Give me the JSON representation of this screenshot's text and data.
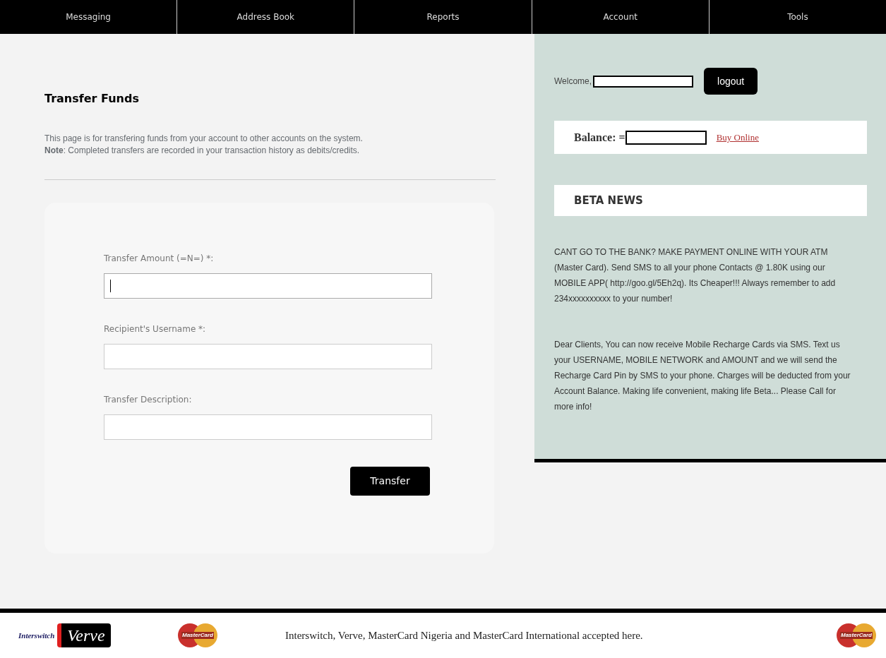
{
  "nav": [
    {
      "label": "Messaging"
    },
    {
      "label": "Address Book"
    },
    {
      "label": "Reports"
    },
    {
      "label": "Account"
    },
    {
      "label": "Tools"
    }
  ],
  "main": {
    "title": "Transfer Funds",
    "intro": "This page is for transfering funds from your account to other accounts on the system.",
    "note": "**Note**: Completed transfers are recorded in your transaction history as debits/credits.",
    "fields": [
      {
        "label": "Transfer Amount (=N=) *:",
        "focused": true
      },
      {
        "label": "Recipient's Username *:",
        "focused": false
      },
      {
        "label": "Transfer Description:",
        "focused": false
      }
    ],
    "submit": "Transfer"
  },
  "sidebar": {
    "welcome": "Welcome,",
    "logout": "logout",
    "balance_label": "Balance: =",
    "buy_link": "Buy Online",
    "news_title": "BETA NEWS",
    "news": [
      "CANT GO TO THE BANK? MAKE PAYMENT ONLINE WITH YOUR ATM (Master Card). Send SMS to all your phone Contacts @ 1.80K using our MOBILE APP( http://goo.gl/5Eh2q). Its Cheaper!!! Always remember to add 234xxxxxxxxxx to your number!",
      "Dear Clients, You can now receive Mobile Recharge Cards via SMS. Text us your USERNAME, MOBILE NETWORK and AMOUNT and we will send the Recharge Card Pin by SMS to your phone. Charges will be deducted from your Account Balance. Making life convenient, making life Beta... Please Call for more info!"
    ]
  },
  "footer": {
    "logos": {
      "interswitch": "Interswitch",
      "verve": "Verve",
      "mastercard": "MasterCard",
      "mastercard_right": "MasterCard"
    },
    "text": "Interswitch, Verve, MasterCard Nigeria and MasterCard International accepted here."
  }
}
